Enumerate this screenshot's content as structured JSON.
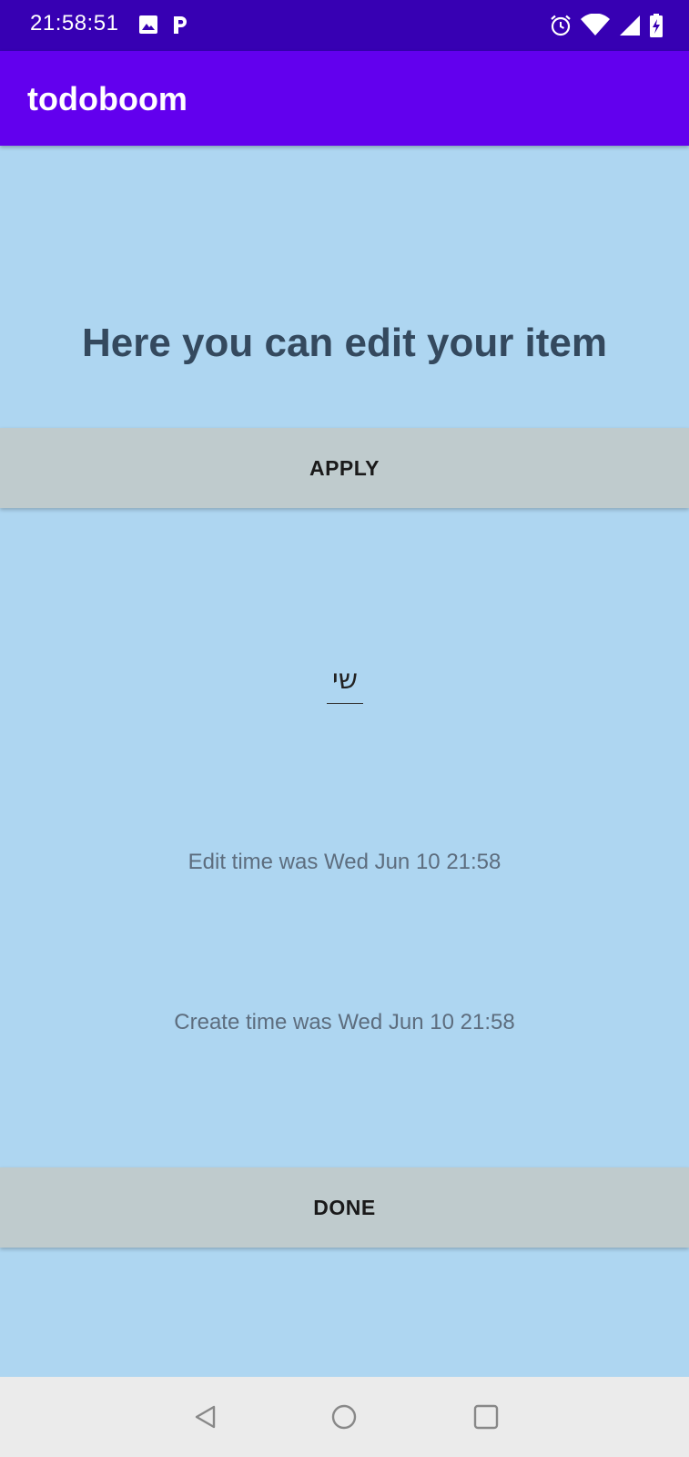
{
  "status_bar": {
    "time": "21:58:51",
    "left_icons": [
      "image-icon",
      "parking-icon"
    ],
    "right_icons": [
      "alarm-icon",
      "wifi-icon",
      "signal-icon",
      "battery-charging-icon"
    ]
  },
  "app_bar": {
    "title": "todoboom"
  },
  "main": {
    "heading": "Here you can edit your item",
    "apply_label": "APPLY",
    "item_value": "שי",
    "edit_time": "Edit time was Wed Jun 10 21:58",
    "create_time": "Create time was Wed Jun 10 21:58",
    "done_label": "DONE"
  },
  "nav_bar": {
    "icons": [
      "back-icon",
      "home-icon",
      "recents-icon"
    ]
  },
  "colors": {
    "status_bar": "#3700b3",
    "app_bar": "#6200ee",
    "background": "#aed6f1",
    "button": "#bfcbcd",
    "heading_text": "#34495e"
  }
}
